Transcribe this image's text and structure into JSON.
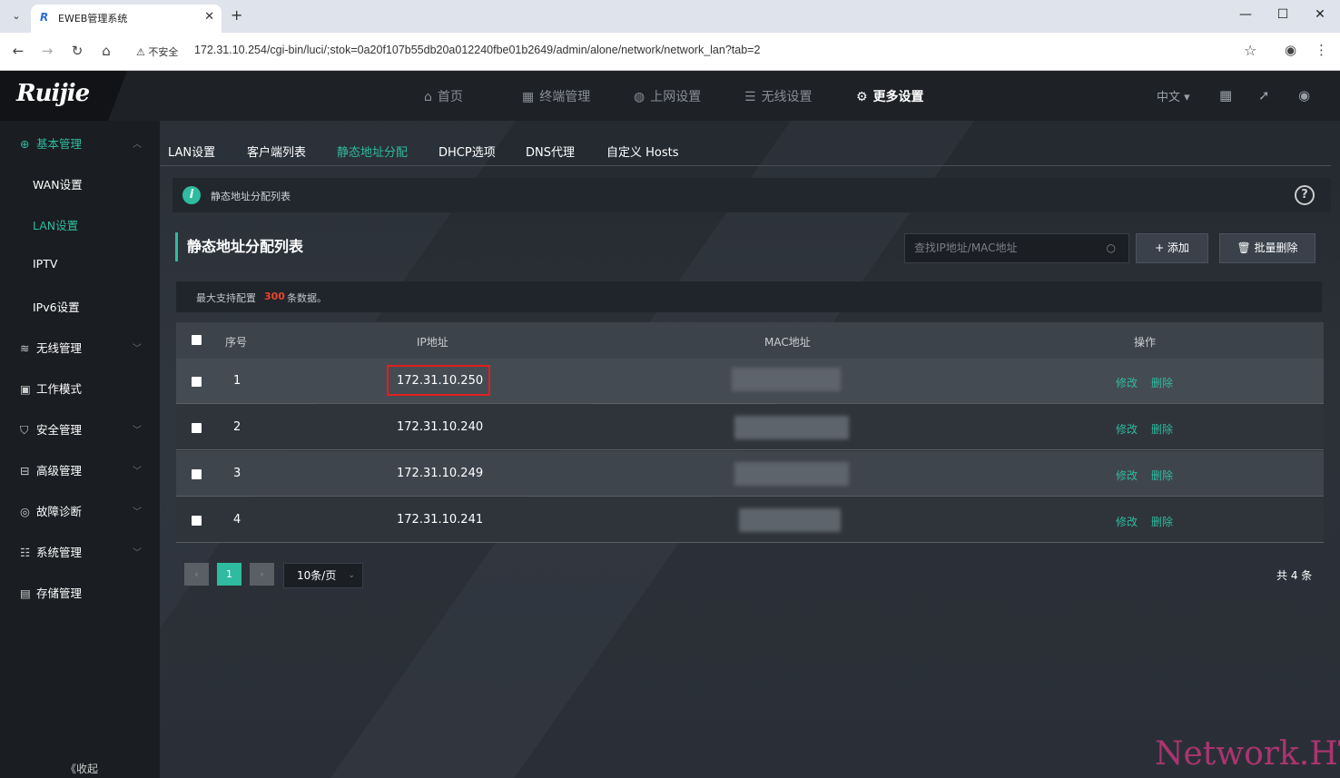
{
  "browser": {
    "tab_title": "EWEB管理系统",
    "tab_icon": "R",
    "new_tab": "+",
    "security": "不安全",
    "url": "172.31.10.254/cgi-bin/luci/;stok=0a20f107b55db20a012240fbe01b2649/admin/alone/network/network_lan?tab=2"
  },
  "app": {
    "logo": "Ruijie",
    "top_nav": [
      {
        "label": "首页",
        "icon": "home-icon"
      },
      {
        "label": "终端管理",
        "icon": "grid-icon"
      },
      {
        "label": "上网设置",
        "icon": "globe-icon"
      },
      {
        "label": "无线设置",
        "icon": "wifi-icon"
      },
      {
        "label": "更多设置",
        "icon": "gear-icon"
      }
    ],
    "lang": "中文",
    "sidebar": {
      "groups": [
        {
          "label": "基本管理",
          "icon": "globe-icon"
        },
        {
          "label": "无线管理",
          "icon": "wifi-icon"
        },
        {
          "label": "工作模式",
          "icon": "mode-icon"
        },
        {
          "label": "安全管理",
          "icon": "shield-icon"
        },
        {
          "label": "高级管理",
          "icon": "advanced-icon"
        },
        {
          "label": "故障诊断",
          "icon": "diagnose-icon"
        },
        {
          "label": "系统管理",
          "icon": "sliders-icon"
        },
        {
          "label": "存储管理",
          "icon": "storage-icon"
        }
      ],
      "sub_items": [
        "WAN设置",
        "LAN设置",
        "IPTV",
        "IPv6设置"
      ],
      "collapse": "《收起"
    },
    "sub_tabs": [
      "LAN设置",
      "客户端列表",
      "静态地址分配",
      "DHCP选项",
      "DNS代理",
      "自定义 Hosts"
    ],
    "info_text": "静态地址分配列表",
    "section_title": "静态地址分配列表",
    "search_placeholder": "查找IP地址/MAC地址",
    "add_button": "+ 添加",
    "batch_delete_button": "🗑 批量删除",
    "max_text_prefix": "最大支持配置",
    "max_num": "300",
    "max_text_suffix": "条数据。",
    "table": {
      "headers": [
        "序号",
        "IP地址",
        "MAC地址",
        "操作"
      ],
      "rows": [
        {
          "index": "1",
          "ip": "172.31.10.250"
        },
        {
          "index": "2",
          "ip": "172.31.10.240"
        },
        {
          "index": "3",
          "ip": "172.31.10.249"
        },
        {
          "index": "4",
          "ip": "172.31.10.241"
        }
      ],
      "edit": "修改",
      "delete": "删除"
    },
    "pagination": {
      "prev": "‹",
      "current": "1",
      "next": "›",
      "page_size": "10条/页",
      "total": "共 4 条"
    },
    "watermark": "Network.HT",
    "colors": {
      "accent": "#2fbba0",
      "highlight": "#e21f1f",
      "max_num": "#e8432e"
    }
  }
}
